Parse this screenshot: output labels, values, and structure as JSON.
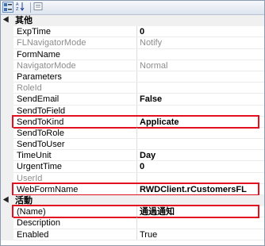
{
  "toolbar": {
    "categorized_icon": "categorized-icon",
    "alphabetical_icon": "alphabetical-icon",
    "property_pages_icon": "property-pages-icon"
  },
  "categories": [
    {
      "label": "其他",
      "rows": [
        {
          "name": "ExpTime",
          "value": "0",
          "bold": true,
          "disabled": false
        },
        {
          "name": "FLNavigatorMode",
          "value": "Notify",
          "bold": false,
          "disabled": true
        },
        {
          "name": "FormName",
          "value": "",
          "bold": false,
          "disabled": false
        },
        {
          "name": "NavigatorMode",
          "value": "Normal",
          "bold": false,
          "disabled": true
        },
        {
          "name": "Parameters",
          "value": "",
          "bold": false,
          "disabled": false
        },
        {
          "name": "RoleId",
          "value": "",
          "bold": false,
          "disabled": true
        },
        {
          "name": "SendEmail",
          "value": "False",
          "bold": true,
          "disabled": false
        },
        {
          "name": "SendToField",
          "value": "",
          "bold": false,
          "disabled": false
        },
        {
          "name": "SendToKind",
          "value": "Applicate",
          "bold": true,
          "disabled": false,
          "highlight": true
        },
        {
          "name": "SendToRole",
          "value": "",
          "bold": false,
          "disabled": false
        },
        {
          "name": "SendToUser",
          "value": "",
          "bold": false,
          "disabled": false
        },
        {
          "name": "TimeUnit",
          "value": "Day",
          "bold": true,
          "disabled": false
        },
        {
          "name": "UrgentTime",
          "value": "0",
          "bold": true,
          "disabled": false
        },
        {
          "name": "UserId",
          "value": "",
          "bold": false,
          "disabled": true
        },
        {
          "name": "WebFormName",
          "value": "RWDClient.rCustomersFL",
          "bold": true,
          "disabled": false,
          "highlight": true
        }
      ]
    },
    {
      "label": "活動",
      "rows": [
        {
          "name": "(Name)",
          "value": "通過通知",
          "bold": true,
          "disabled": false,
          "highlight": true
        },
        {
          "name": "Description",
          "value": "",
          "bold": false,
          "disabled": false
        },
        {
          "name": "Enabled",
          "value": "True",
          "bold": false,
          "disabled": false
        }
      ]
    }
  ],
  "highlight_color": "#e3101f"
}
